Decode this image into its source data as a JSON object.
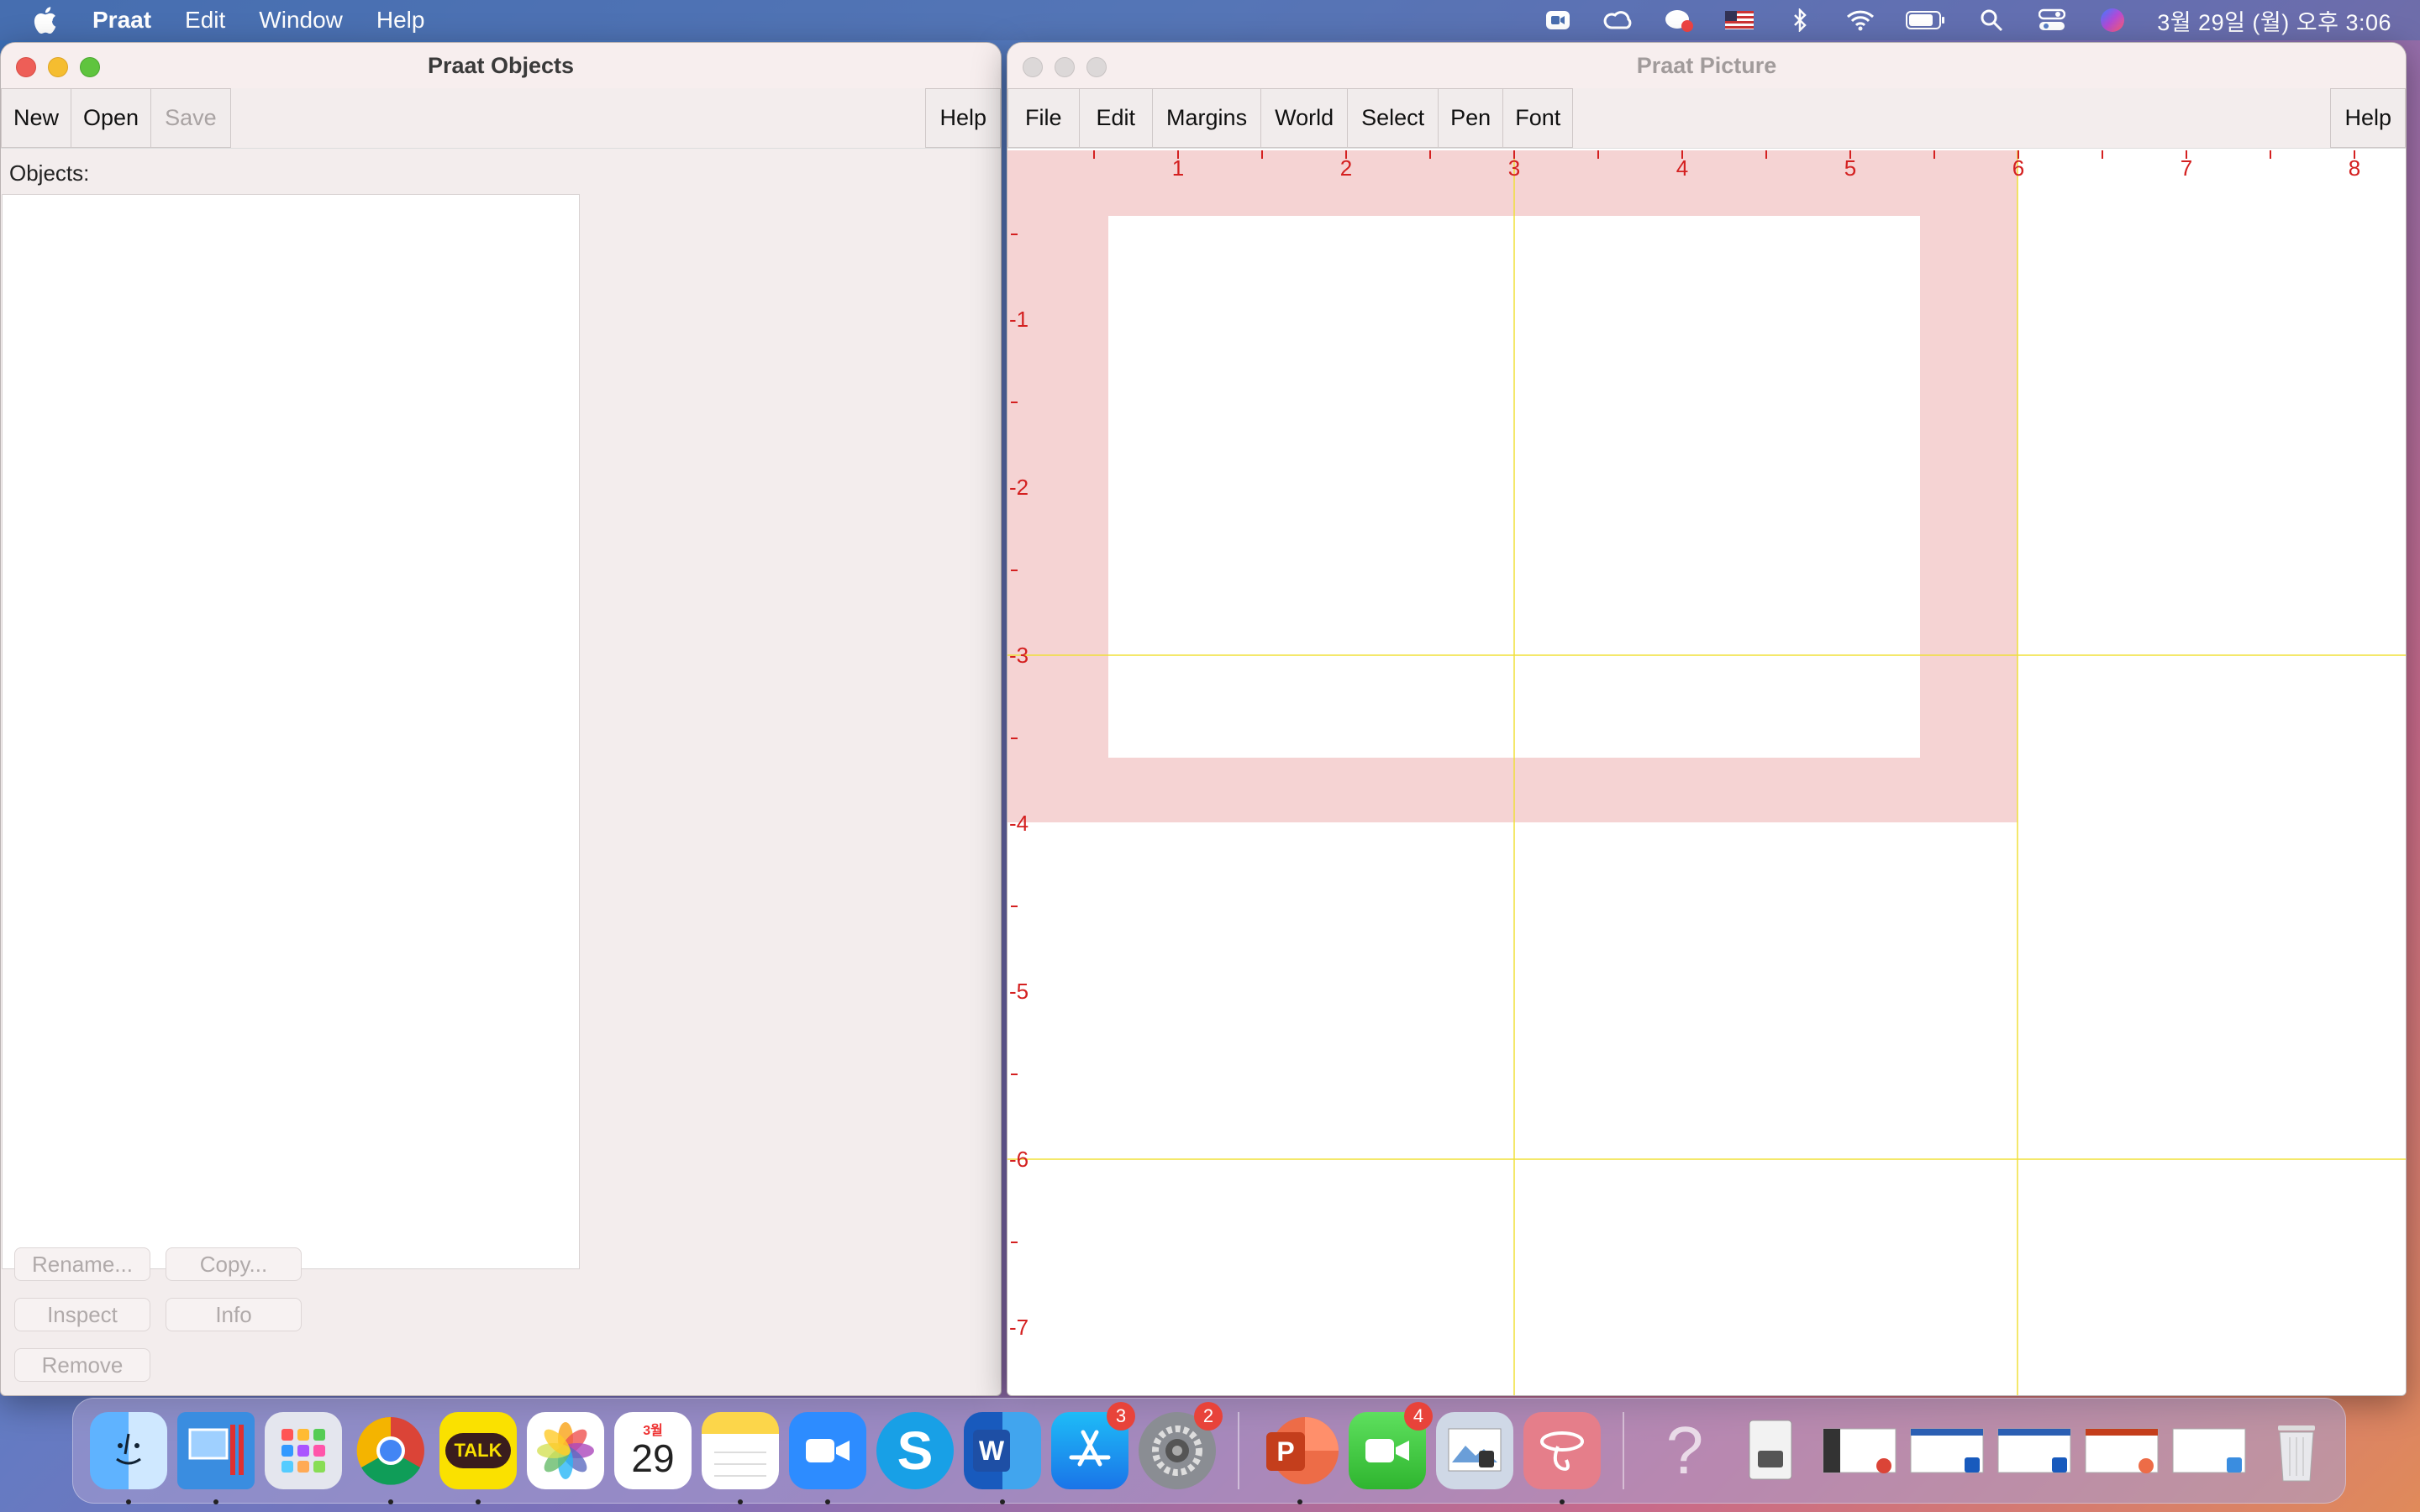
{
  "menubar": {
    "app_name": "Praat",
    "menus": [
      "Edit",
      "Window",
      "Help"
    ],
    "clock": "3월 29일 (월) 오후 3:06",
    "status_icons": [
      "zoom-icon",
      "creative-cloud-icon",
      "kakaotalk-status-icon",
      "us-flag-icon",
      "bluetooth-icon",
      "wifi-icon",
      "battery-icon",
      "spotlight-search-icon",
      "control-center-icon",
      "siri-icon"
    ]
  },
  "objects_window": {
    "title": "Praat Objects",
    "toolbar": {
      "new": "New",
      "open": "Open",
      "save": "Save",
      "help": "Help"
    },
    "objects_label": "Objects:",
    "buttons": {
      "rename": "Rename...",
      "copy": "Copy...",
      "inspect": "Inspect",
      "info": "Info",
      "remove": "Remove"
    }
  },
  "picture_window": {
    "title": "Praat Picture",
    "menus": [
      "File",
      "Edit",
      "Margins",
      "World",
      "Select",
      "Pen",
      "Font"
    ],
    "help": "Help",
    "ruler_x_labels": [
      "1",
      "2",
      "3",
      "4",
      "5",
      "6",
      "7",
      "8"
    ],
    "ruler_y_labels": [
      "-1",
      "-2",
      "-3",
      "-4",
      "-5",
      "-6",
      "-7"
    ],
    "colors": {
      "ruler": "#d42020",
      "selection": "#f5d3d3",
      "grid": "#f0e03a"
    }
  },
  "dock": {
    "apps": [
      "finder-icon",
      "parallels-icon",
      "launchpad-icon",
      "chrome-icon",
      "kakaotalk-icon",
      "photos-icon",
      "calendar-icon",
      "notes-icon",
      "zoom-icon",
      "skype-icon",
      "word-icon",
      "app-store-icon",
      "system-preferences-icon",
      "powerpoint-icon",
      "facetime-icon",
      "preview-icon",
      "praat-icon"
    ],
    "calendar_month": "3월",
    "calendar_day": "29",
    "kakaotalk_label": "TALK",
    "badges": {
      "app_store": "3",
      "system_preferences": "2",
      "facetime": "4"
    },
    "help_glyph": "?"
  }
}
